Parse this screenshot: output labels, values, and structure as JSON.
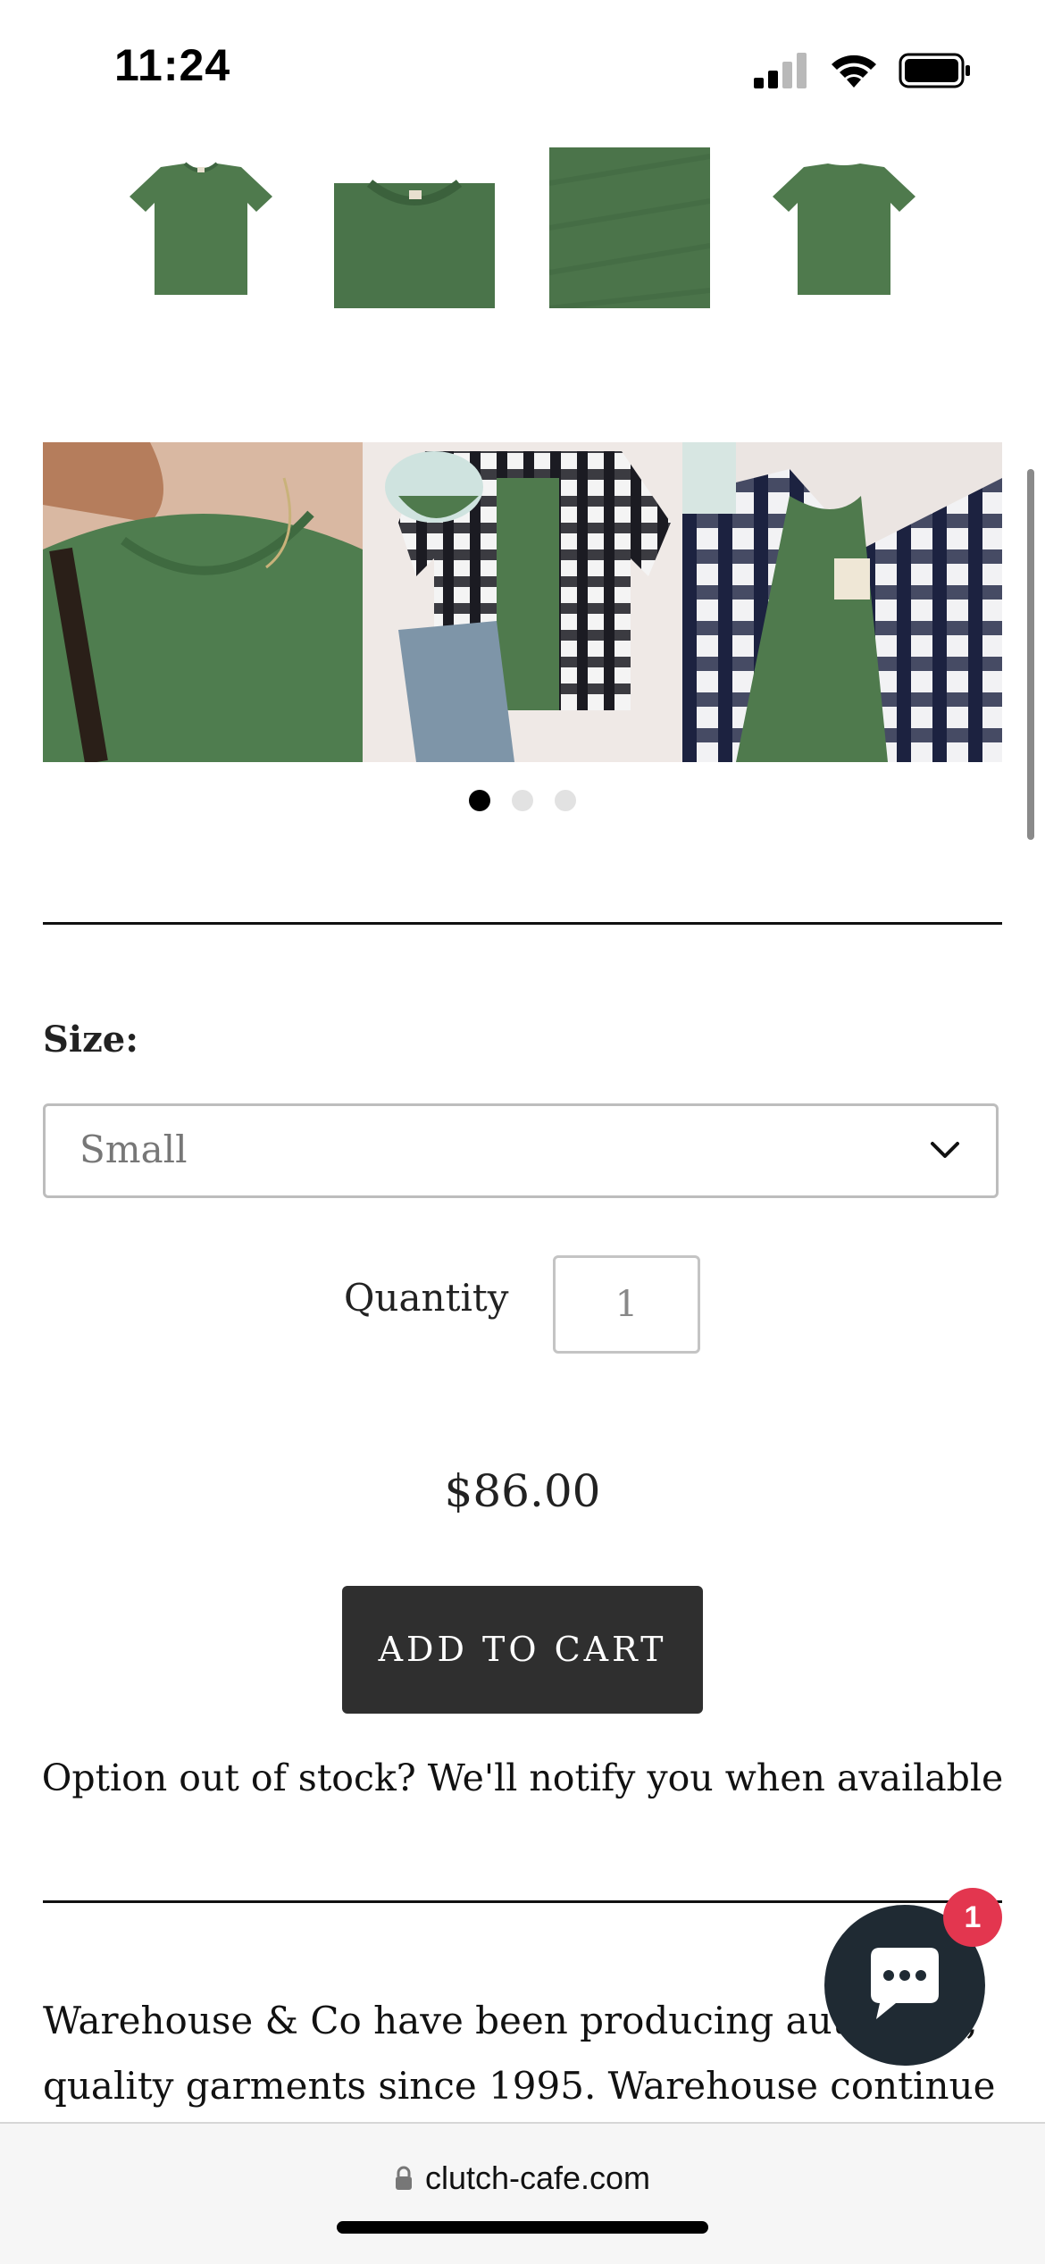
{
  "status_bar": {
    "time": "11:24",
    "icons": [
      "signal-icon",
      "wifi-icon",
      "battery-icon"
    ]
  },
  "product": {
    "thumbnail_count": 4,
    "gallery_slide_count": 3,
    "active_slide": 1,
    "size_label": "Size:",
    "size_selected": "Small",
    "quantity_label": "Quantity",
    "quantity_value": "1",
    "price": "$86.00",
    "add_to_cart_label": "ADD TO CART",
    "notify_text": "Option out of stock? We'll notify you when available",
    "description": "Warehouse & Co have been producing authentic, quality garments since 1995. Warehouse continue with"
  },
  "chat": {
    "badge_count": "1",
    "icon": "chat-icon"
  },
  "browser": {
    "url": "clutch-cafe.com",
    "icon": "lock-icon"
  },
  "colors": {
    "shirt_green": "#4f7a4d",
    "button_bg": "#2f2f2f",
    "badge_red": "#e3364f",
    "chat_bg": "#1f2a33"
  }
}
